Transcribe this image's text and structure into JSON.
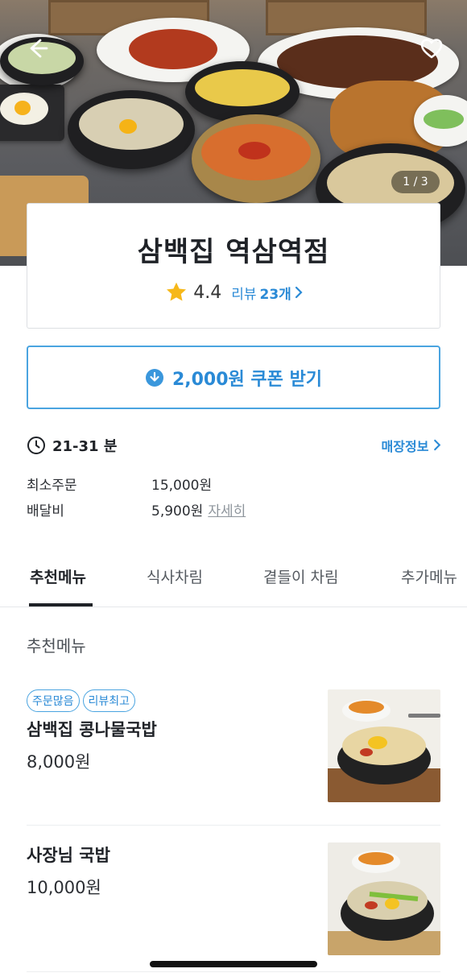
{
  "hero": {
    "page_indicator": "1 / 3",
    "icons": {
      "back": "back-arrow-icon",
      "favorite": "heart-icon"
    }
  },
  "store": {
    "name": "삼백집 역삼역점",
    "rating": "4.4",
    "review_label": "리뷰",
    "review_count": "23개"
  },
  "coupon": {
    "label": "2,000원 쿠폰 받기",
    "icon": "download-icon"
  },
  "info": {
    "delivery_time": "21-31 분",
    "store_info_link": "매장정보",
    "min_order_label": "최소주문",
    "min_order_value": "15,000원",
    "delivery_fee_label": "배달비",
    "delivery_fee_value": "5,900원",
    "detail_link": "자세히"
  },
  "tabs": [
    "추천메뉴",
    "식사차림",
    "곁들이 차림",
    "추가메뉴"
  ],
  "section_title": "추천메뉴",
  "menu": [
    {
      "badges": [
        "주문많음",
        "리뷰최고"
      ],
      "name": "삼백집 콩나물국밥",
      "price": "8,000원"
    },
    {
      "badges": [],
      "name": "사장님 국밥",
      "price": "10,000원"
    }
  ],
  "colors": {
    "accent": "#2a8ad6",
    "star": "#f6b81a",
    "text": "#1f2227"
  }
}
